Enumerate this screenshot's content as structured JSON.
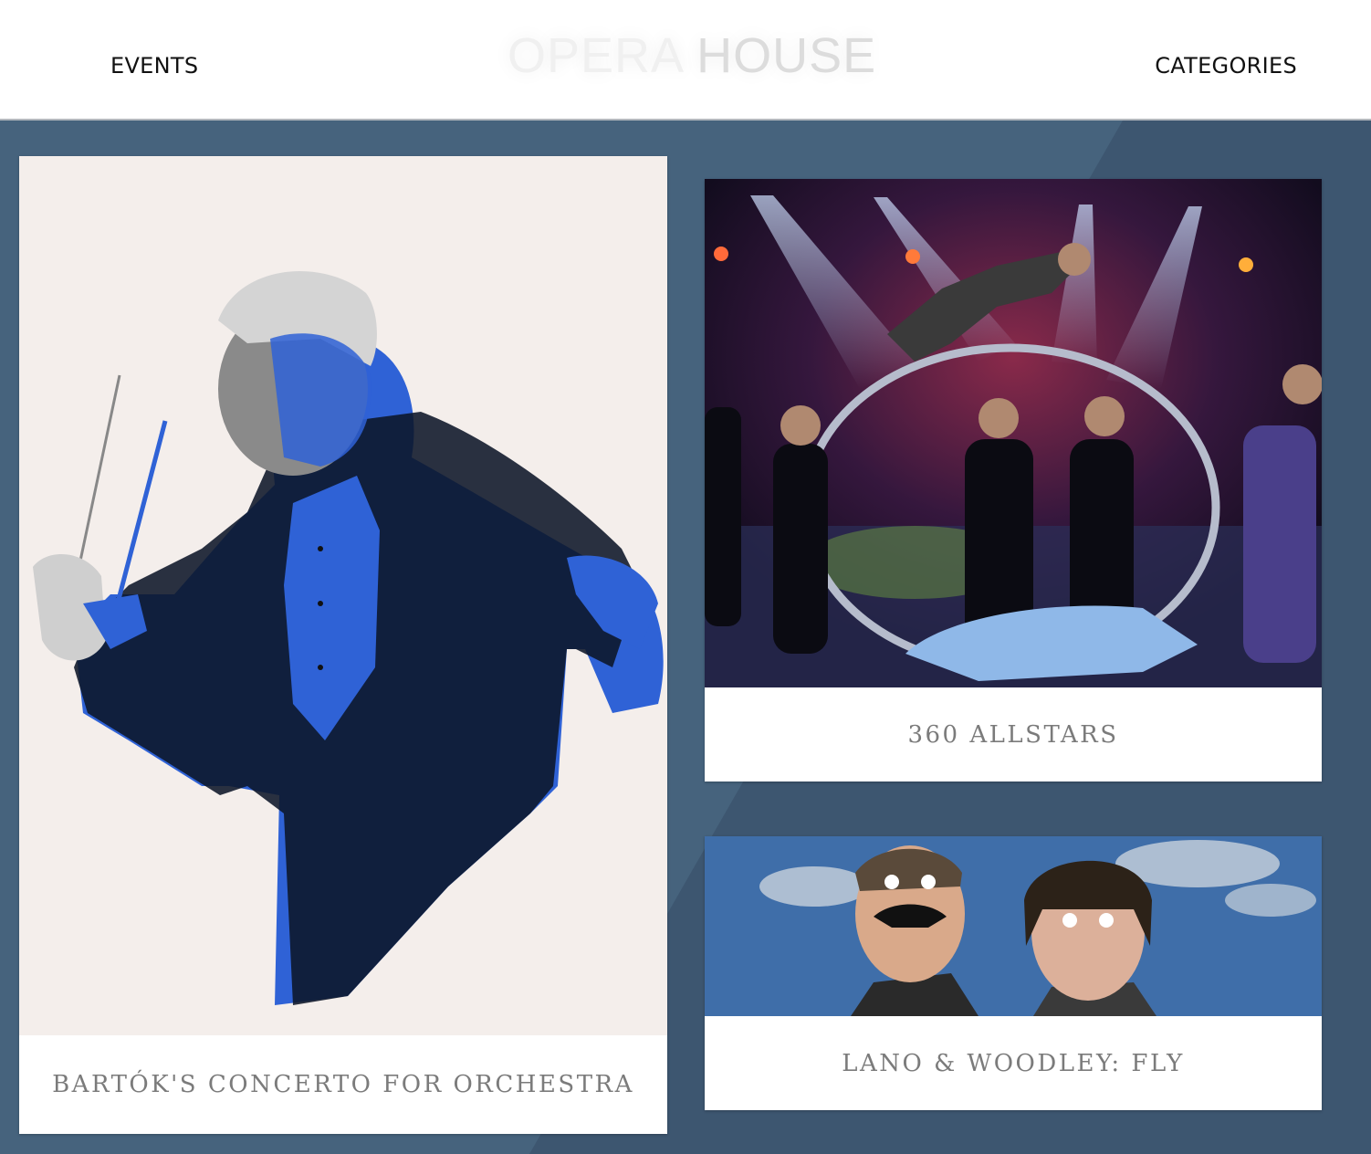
{
  "header": {
    "nav_left": "EVENTS",
    "nav_right": "CATEGORIES",
    "logo_word1": "OPERA",
    "logo_word2": "HOUSE"
  },
  "colors": {
    "page_background": "#46637d",
    "accent_blue": "#2f62d6",
    "caption_text": "#7b7b7b"
  },
  "events": [
    {
      "title": "BARTÓK'S CONCERTO FOR ORCHESTRA",
      "image": "conductor-with-baton-photo"
    },
    {
      "title": "360 ALLSTARS",
      "image": "acrobat-on-hoop-stage-photo"
    },
    {
      "title": "LANO & WOODLEY: FLY",
      "image": "two-performers-sky-photo"
    }
  ]
}
